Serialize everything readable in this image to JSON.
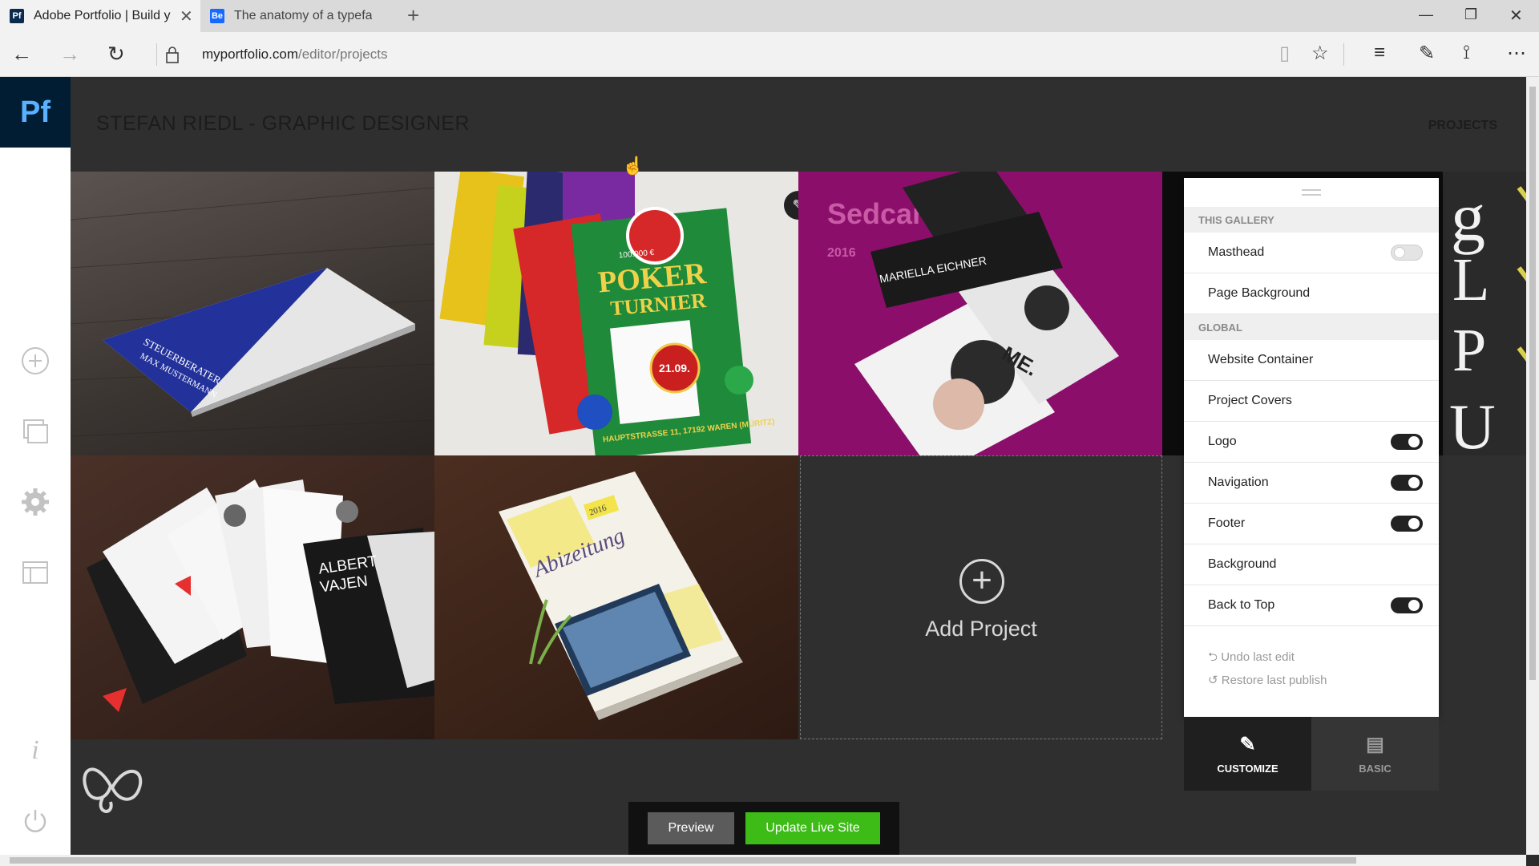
{
  "browser": {
    "tabs": [
      {
        "label": "Adobe Portfolio | Build y",
        "favicon": "Pf",
        "favicon_color": "#0a2b4e",
        "active": true
      },
      {
        "label": "The anatomy of a typeface (",
        "favicon": "Be",
        "favicon_color": "#1769ff",
        "active": false
      }
    ],
    "url_domain": "myportfolio.com",
    "url_path": "/editor/projects"
  },
  "rail": {
    "logo": "Pf",
    "icons": [
      "add-icon",
      "pages-icon",
      "settings-icon",
      "layout-icon",
      "info-icon",
      "power-icon"
    ]
  },
  "site": {
    "title": "STEFAN RIEDL - GRAPHIC DESIGNER",
    "nav": "PROJECTS"
  },
  "tiles": {
    "t1_text": [
      "STEUERBERATER",
      "MAX MUSTERMANN"
    ],
    "t2_text": [
      "POKER",
      "TURNIER",
      "21.09.",
      "HAUPTSTRASSE 11, 17192 WAREN (MÜRITZ)",
      "100.000 €"
    ],
    "t3_text": [
      "Sedcards",
      "2016",
      "MARIELLA EICHNER",
      "ME."
    ],
    "t4_text": [
      "g",
      "L",
      "P",
      "U"
    ],
    "t5_text": [
      "ALBERT",
      "VAJEN"
    ],
    "t6_text": [
      "Abizeitung",
      "2016"
    ]
  },
  "add_project": {
    "label": "Add Project"
  },
  "panel": {
    "section_gallery": "THIS GALLERY",
    "gallery_rows": [
      {
        "label": "Masthead",
        "toggle": "off"
      },
      {
        "label": "Page Background",
        "toggle": null
      }
    ],
    "section_global": "GLOBAL",
    "global_rows": [
      {
        "label": "Website Container",
        "toggle": null
      },
      {
        "label": "Project Covers",
        "toggle": null
      },
      {
        "label": "Logo",
        "toggle": "on"
      },
      {
        "label": "Navigation",
        "toggle": "on"
      },
      {
        "label": "Footer",
        "toggle": "on"
      },
      {
        "label": "Background",
        "toggle": null
      },
      {
        "label": "Back to Top",
        "toggle": "on"
      }
    ],
    "undo": "Undo last edit",
    "restore": "Restore last publish",
    "tab_customize": "CUSTOMIZE",
    "tab_basic": "BASIC"
  },
  "publish": {
    "preview": "Preview",
    "update": "Update Live Site",
    "colors": {
      "update": "#3dbb16",
      "preview": "#5b5b5b"
    }
  }
}
